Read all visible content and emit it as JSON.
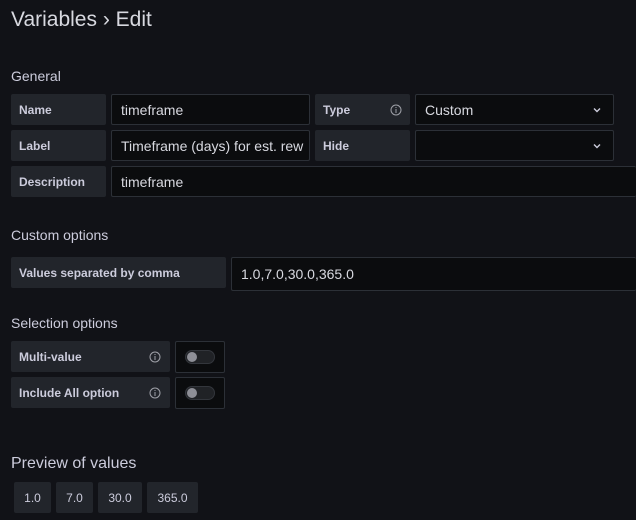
{
  "page": {
    "title": "Variables › Edit"
  },
  "general": {
    "heading": "General",
    "name": {
      "label": "Name",
      "value": "timeframe"
    },
    "type": {
      "label": "Type",
      "value": "Custom"
    },
    "label_field": {
      "label": "Label",
      "value": "Timeframe (days) for est. rew"
    },
    "hide": {
      "label": "Hide",
      "value": ""
    },
    "description": {
      "label": "Description",
      "value": "timeframe"
    }
  },
  "custom_options": {
    "heading": "Custom options",
    "values_label": "Values separated by comma",
    "values": "1.0,7.0,30.0,365.0"
  },
  "selection_options": {
    "heading": "Selection options",
    "multi_value": {
      "label": "Multi-value",
      "enabled": false
    },
    "include_all": {
      "label": "Include All option",
      "enabled": false
    }
  },
  "preview": {
    "heading": "Preview of values",
    "values": [
      "1.0",
      "7.0",
      "30.0",
      "365.0"
    ]
  },
  "icons": {
    "info": "info-circle-icon",
    "dropdown": "chevron-down-icon"
  },
  "colors": {
    "background": "#111217",
    "label_bg": "#22252b",
    "input_bg": "#0b0c0e",
    "border": "#2c3037",
    "text": "#ccccdc"
  }
}
